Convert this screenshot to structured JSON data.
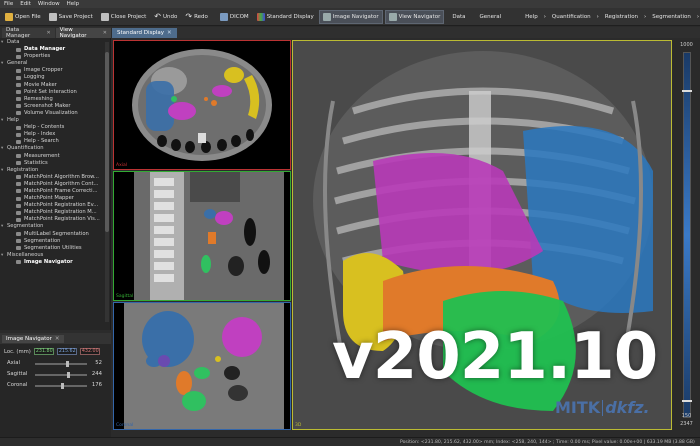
{
  "menu": [
    "File",
    "Edit",
    "Window",
    "Help"
  ],
  "toolbar": {
    "open_file": "Open File",
    "save_project": "Save Project",
    "close_project": "Close Project",
    "undo": "Undo",
    "redo": "Redo",
    "dicom": "DICOM",
    "standard_display": "Standard Display",
    "image_navigator": "Image Navigator",
    "view_navigator": "View Navigator",
    "data": "Data",
    "general": "General",
    "help": "Help",
    "quantification": "Quantification",
    "registration": "Registration",
    "segmentation": "Segmentation"
  },
  "left_tabs": {
    "data_manager": "Data Manager",
    "view_navigator": "View Navigator"
  },
  "nav": [
    {
      "group": "Data",
      "items": [
        {
          "label": "Data Manager",
          "bold": true
        },
        {
          "label": "Properties"
        }
      ]
    },
    {
      "group": "General",
      "items": [
        {
          "label": "Image Cropper"
        },
        {
          "label": "Logging"
        },
        {
          "label": "Movie Maker"
        },
        {
          "label": "Point Set Interaction"
        },
        {
          "label": "Remeshing"
        },
        {
          "label": "Screenshot Maker"
        },
        {
          "label": "Volume Visualization"
        }
      ]
    },
    {
      "group": "Help",
      "items": [
        {
          "label": "Help - Contents"
        },
        {
          "label": "Help - Index"
        },
        {
          "label": "Help - Search"
        }
      ]
    },
    {
      "group": "Quantification",
      "items": [
        {
          "label": "Measurement"
        },
        {
          "label": "Statistics"
        }
      ]
    },
    {
      "group": "Registration",
      "items": [
        {
          "label": "MatchPoint Algorithm Brow..."
        },
        {
          "label": "MatchPoint Algorithm Cont..."
        },
        {
          "label": "MatchPoint Frame Correcti..."
        },
        {
          "label": "MatchPoint Mapper"
        },
        {
          "label": "MatchPoint Registration Ev..."
        },
        {
          "label": "MatchPoint Registration M..."
        },
        {
          "label": "MatchPoint Registration Vis..."
        }
      ]
    },
    {
      "group": "Segmentation",
      "items": [
        {
          "label": "MultiLabel Segmentation"
        },
        {
          "label": "Segmentation"
        },
        {
          "label": "Segmentation Utilities"
        }
      ]
    },
    {
      "group": "Miscellaneous",
      "items": [
        {
          "label": "Image Navigator",
          "bold": true
        }
      ]
    }
  ],
  "image_navigator": {
    "title": "Image Navigator",
    "loc_label": "Loc. (mm)",
    "loc_x": "231.80",
    "loc_y": "215.62",
    "loc_z": "432.00",
    "axial_label": "Axial",
    "axial_value": "52",
    "axial_fraction": 0.6,
    "sagittal_label": "Sagittal",
    "sagittal_value": "244",
    "sagittal_fraction": 0.62,
    "coronal_label": "Coronal",
    "coronal_value": "176",
    "coronal_fraction": 0.5
  },
  "render_tab": "Standard Display",
  "view_labels": {
    "axial": "Axial",
    "sagittal": "Sagittal",
    "coronal": "Coronal",
    "three_d": "3D"
  },
  "colorbar": {
    "top_value": "1000",
    "bottom_value": "150",
    "bottom_value_2": "2347"
  },
  "version_text": "v2021.10",
  "logo": {
    "mitk": "MITK",
    "dkfz": "dkfz."
  },
  "status_text": "Position: <231.80, 215.62, 432.00> mm; Index: <258, 240, 144> ; Time: 0.00 ms; Pixel value: 0.00e+00 | 633.19 MB (3.88 GB)",
  "colors": {
    "accent": "#4e6c8c",
    "axial_border": "#b33333",
    "sagittal_border": "#33aa33",
    "coronal_border": "#3366aa",
    "three_d_border": "#bbbb33"
  }
}
